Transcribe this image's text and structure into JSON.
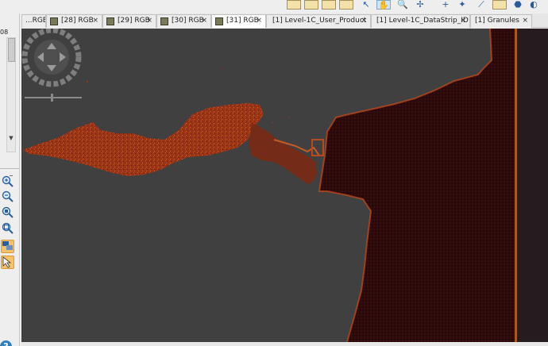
{
  "tabs": [
    {
      "label": "...RGE"
    },
    {
      "label": "[28] RGB"
    },
    {
      "label": "[29] RGB"
    },
    {
      "label": "[30] RGB"
    },
    {
      "label": "[31] RGB"
    },
    {
      "label": "[1] Level-1C_User_Product"
    },
    {
      "label": "[1] Level-1C_DataStrip_ID"
    },
    {
      "label": "[1] Granules"
    }
  ],
  "tab_close_glyph": "×",
  "left_panel": {
    "ruler_value": "08",
    "tools": [
      "zoom-in-icon",
      "zoom-out-icon",
      "zoom-pixel-icon",
      "zoom-all-icon",
      "sync-views-icon",
      "sync-cursor-icon"
    ],
    "help_label": "?"
  },
  "colors": {
    "view_background": "#404040",
    "water_body": "#2a0a0c",
    "land_orange": "#b3441c",
    "selected_tool": "#f5c26b"
  }
}
